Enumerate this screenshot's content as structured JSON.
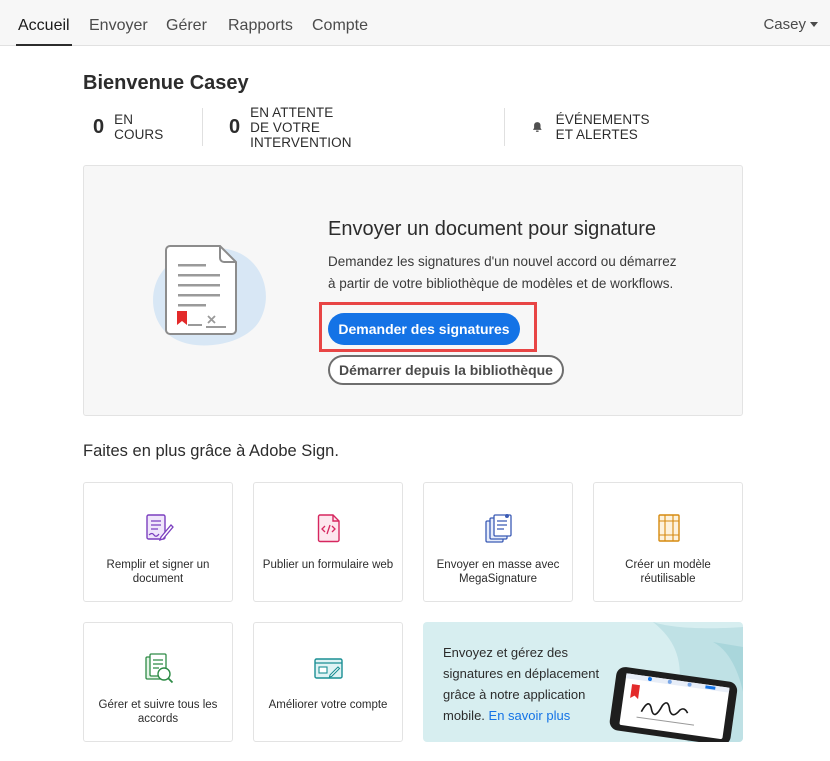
{
  "nav": {
    "tabs": [
      "Accueil",
      "Envoyer",
      "Gérer",
      "Rapports",
      "Compte"
    ],
    "user": "Casey"
  },
  "welcome": "Bienvenue Casey",
  "stats": {
    "in_progress_count": "0",
    "in_progress_label": "EN COURS",
    "waiting_count": "0",
    "waiting_label": "EN ATTENTE DE VOTRE INTERVENTION",
    "events_label": "ÉVÉNEMENTS ET ALERTES"
  },
  "hero": {
    "title": "Envoyer un document pour signature",
    "description": "Demandez les signatures d'un nouvel accord ou démarrez à partir de votre bibliothèque de modèles et de workflows.",
    "primary_button": "Demander des signatures",
    "secondary_button": "Démarrer depuis la bibliothèque"
  },
  "more": {
    "heading": "Faites en plus grâce à Adobe Sign.",
    "cards": [
      "Remplir et signer un document",
      "Publier un formulaire web",
      "Envoyer en masse avec MegaSignature",
      "Créer un modèle réutilisable",
      "Gérer et suivre tous les accords",
      "Améliorer votre compte"
    ],
    "promo_text": "Envoyez et gérez des signatures en déplacement grâce à notre application mobile.",
    "promo_link": "En savoir plus"
  },
  "colors": {
    "accent": "#1473e6",
    "highlight": "#e84545",
    "promo_bg": "#d7eef0"
  }
}
